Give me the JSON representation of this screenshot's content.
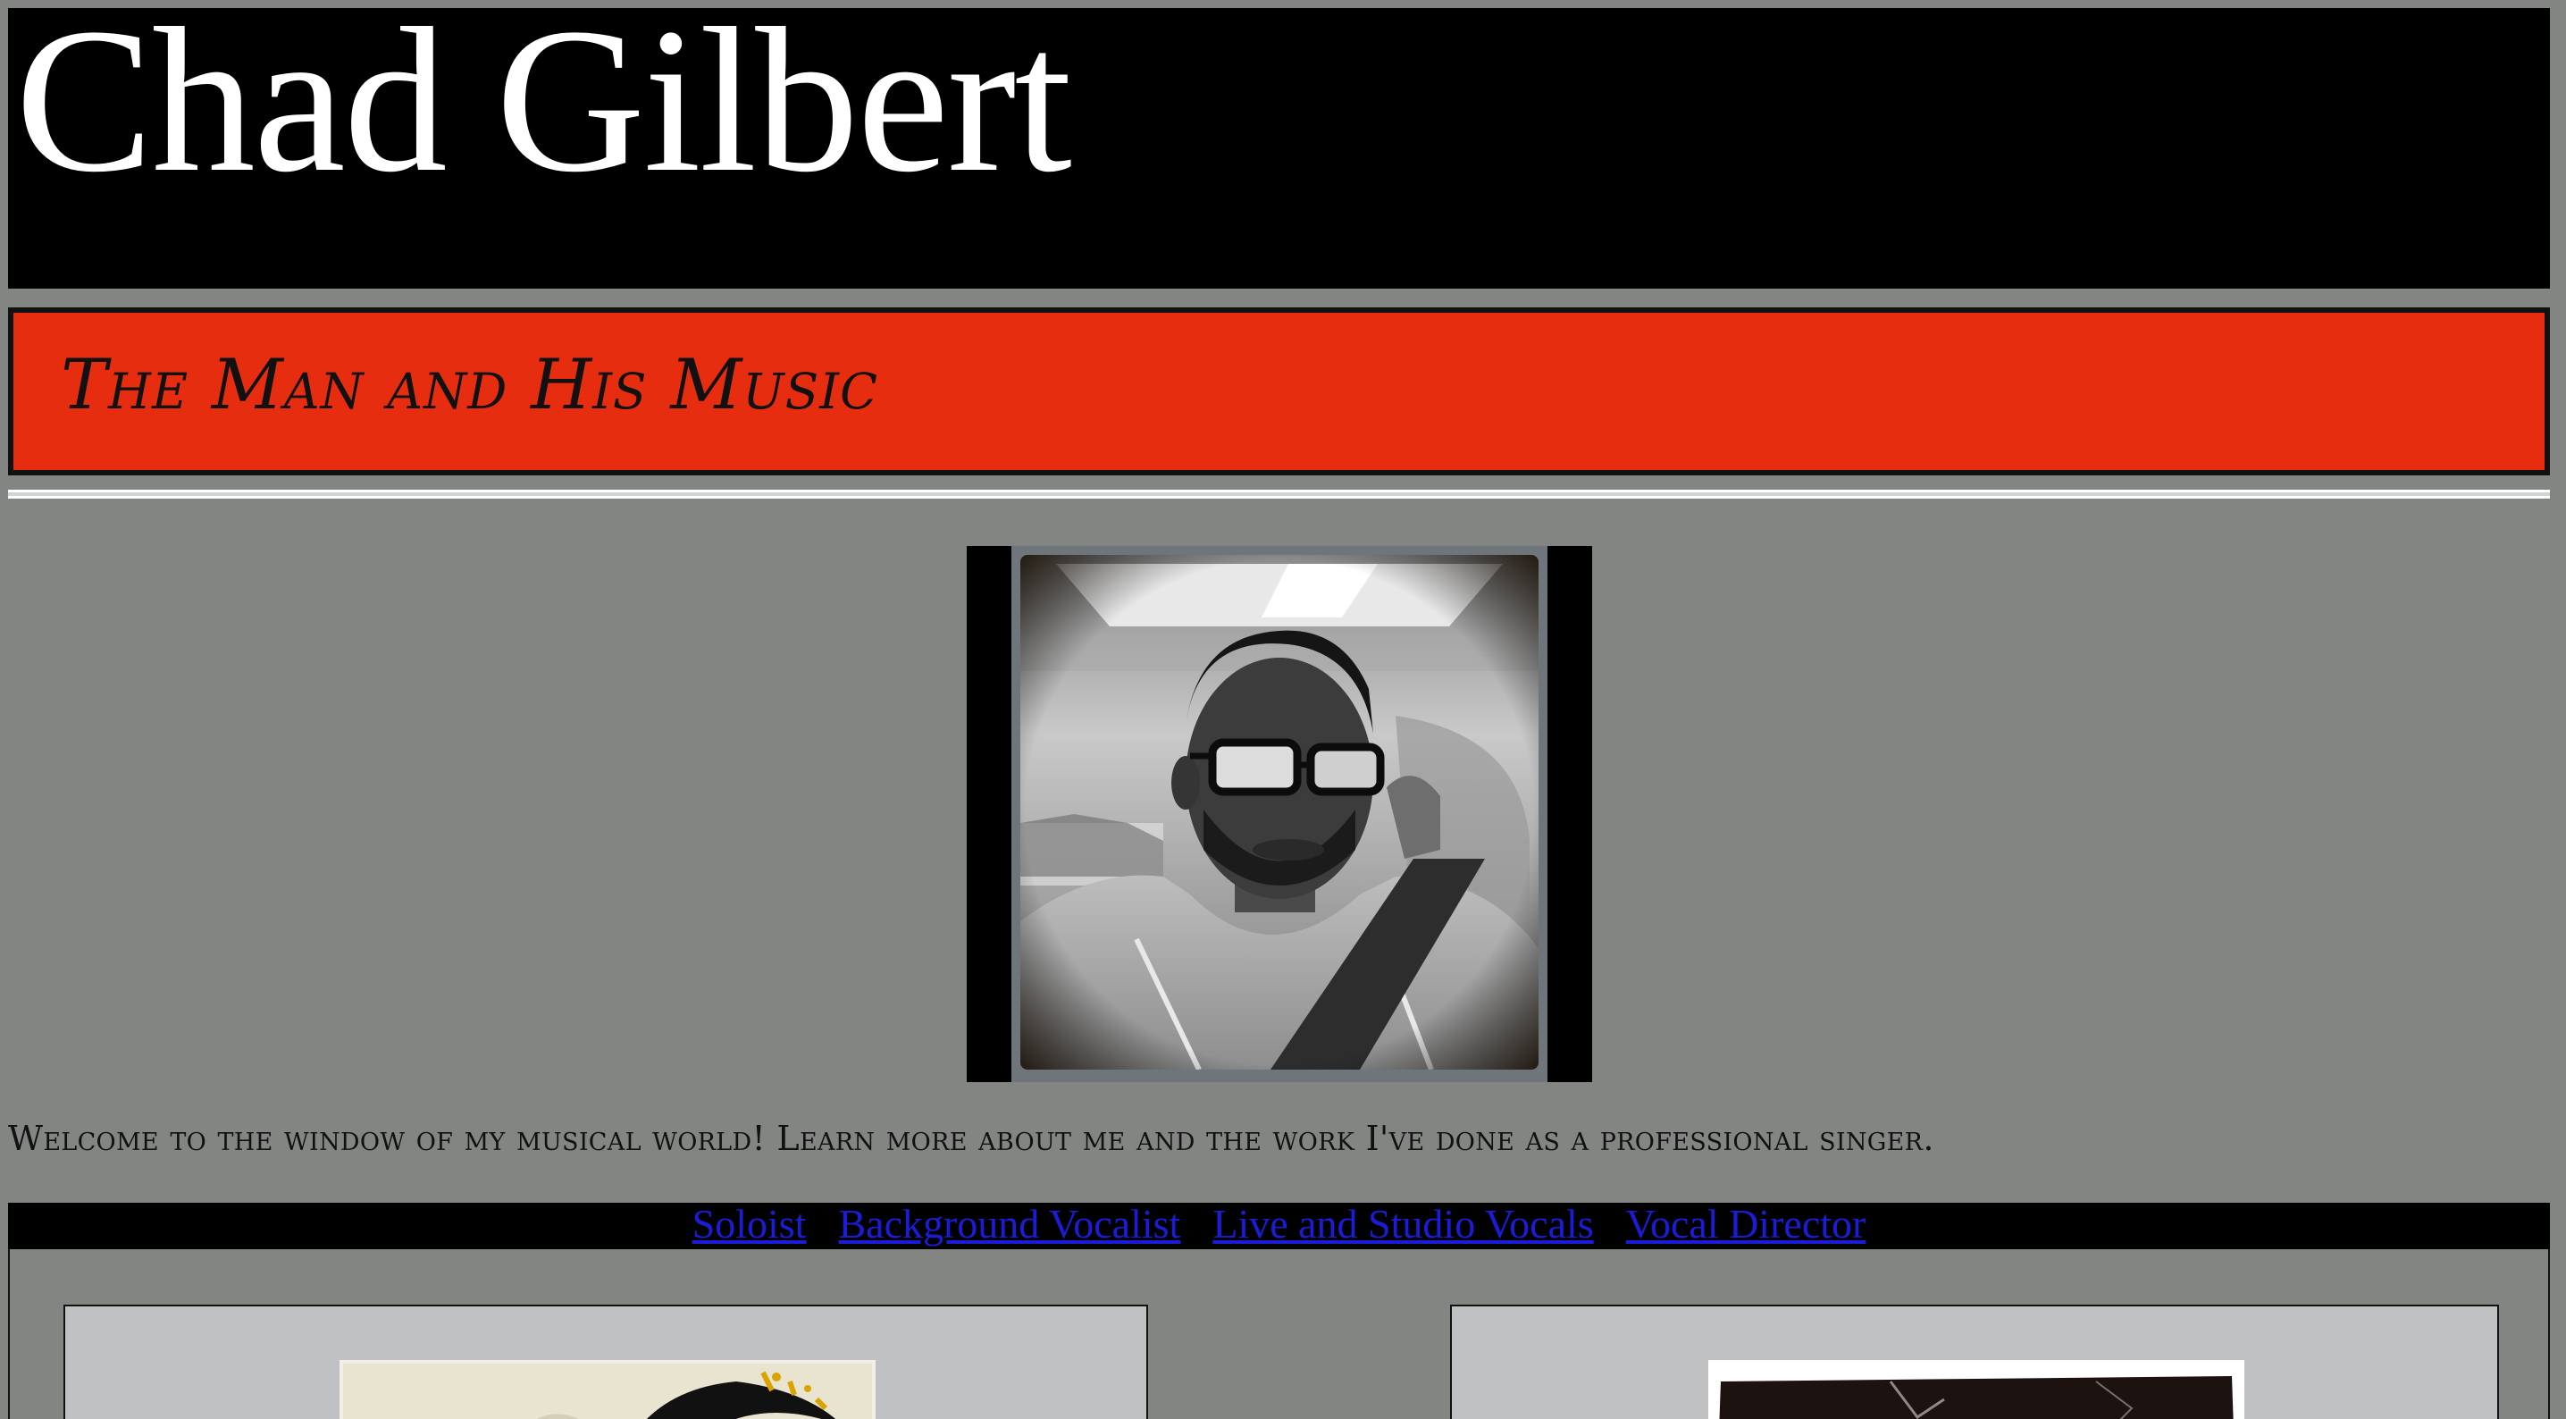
{
  "header": {
    "title": "Chad Gilbert"
  },
  "tagline": {
    "text": "The Man and His Music"
  },
  "intro": {
    "welcome_text": "Welcome to the window of my musical world! Learn more about me and the work I've done as a professional singer."
  },
  "nav": {
    "links": [
      {
        "label": "Soloist"
      },
      {
        "label": "Background Vocalist"
      },
      {
        "label": "Live and Studio Vocals"
      },
      {
        "label": "Vocal Director"
      }
    ]
  },
  "colors": {
    "page_background": "#838583",
    "header_background": "#000000",
    "tagline_background": "#e72d10",
    "link": "#1c1cd8",
    "card_background": "#bfc1c3"
  }
}
